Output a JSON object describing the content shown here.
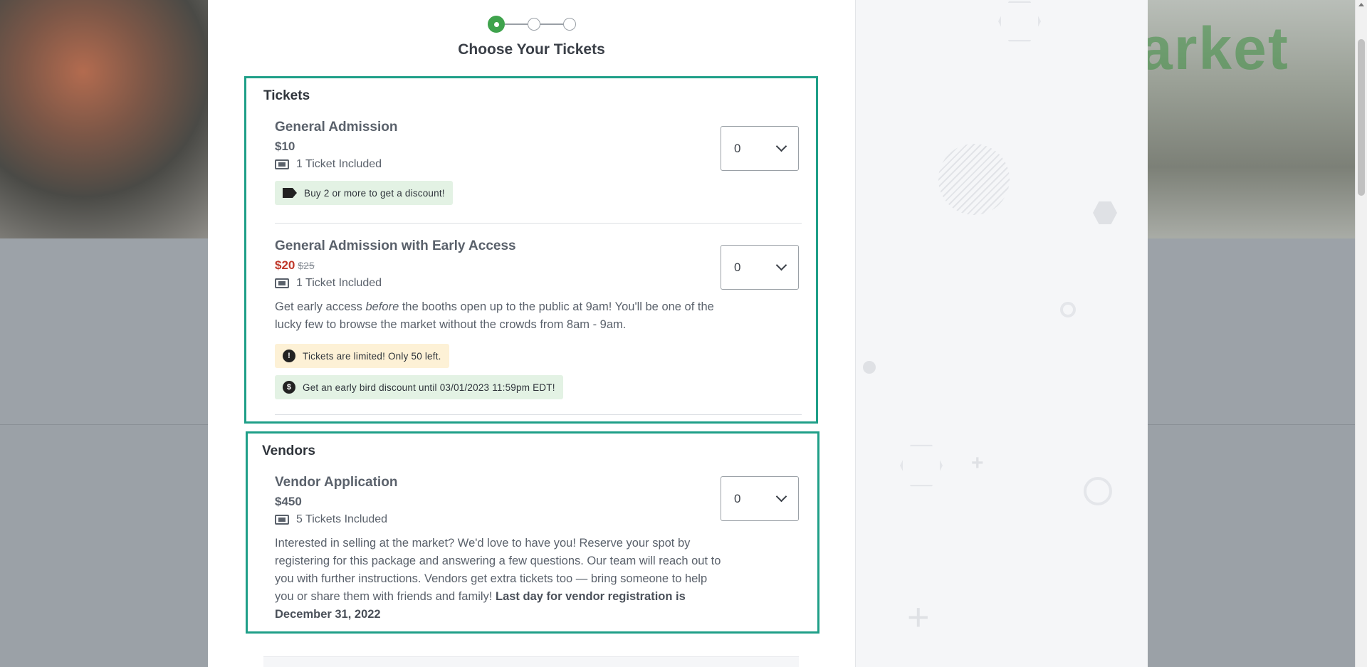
{
  "stepper": {
    "steps": 3,
    "active": 1
  },
  "title": "Choose Your Tickets",
  "tickets_section": {
    "title": "Tickets",
    "items": [
      {
        "name": "General Admission",
        "price": "$10",
        "included": "1 Ticket Included",
        "quantity": "0",
        "badges": [
          {
            "text": "Buy 2 or more to get a discount!",
            "icon": "tag-icon"
          }
        ]
      },
      {
        "name": "General Admission with Early Access",
        "price": "$20",
        "original_price": "$25",
        "included": "1 Ticket Included",
        "quantity": "0",
        "description_pre": "Get early access ",
        "description_em": "before",
        "description_post": " the booths open up to the public at 9am! You'll be one of the lucky few to browse the market without the crowds from 8am - 9am.",
        "badges": [
          {
            "text": "Tickets are limited! Only 50 left.",
            "icon": "exclamation-icon"
          },
          {
            "text": "Get an early bird discount until 03/01/2023 11:59pm EDT!",
            "icon": "dollar-icon"
          }
        ]
      }
    ]
  },
  "vendors_section": {
    "title": "Vendors",
    "items": [
      {
        "name": "Vendor Application",
        "price": "$450",
        "included": "5 Tickets Included",
        "quantity": "0",
        "description": "Interested in selling at the market? We'd love to have you! Reserve your spot by registering for this package and answering a few questions. Our team will reach out to you with further instructions. Vendors get extra tickets too — bring someone to help you or share them with friends and family! ",
        "description_bold": "Last day for vendor registration is December 31, 2022"
      }
    ]
  },
  "background": {
    "brand_text": "arket"
  },
  "colors": {
    "accent": "#3fa34d",
    "highlight_border": "#1f9f88",
    "sale": "#c0392b"
  }
}
